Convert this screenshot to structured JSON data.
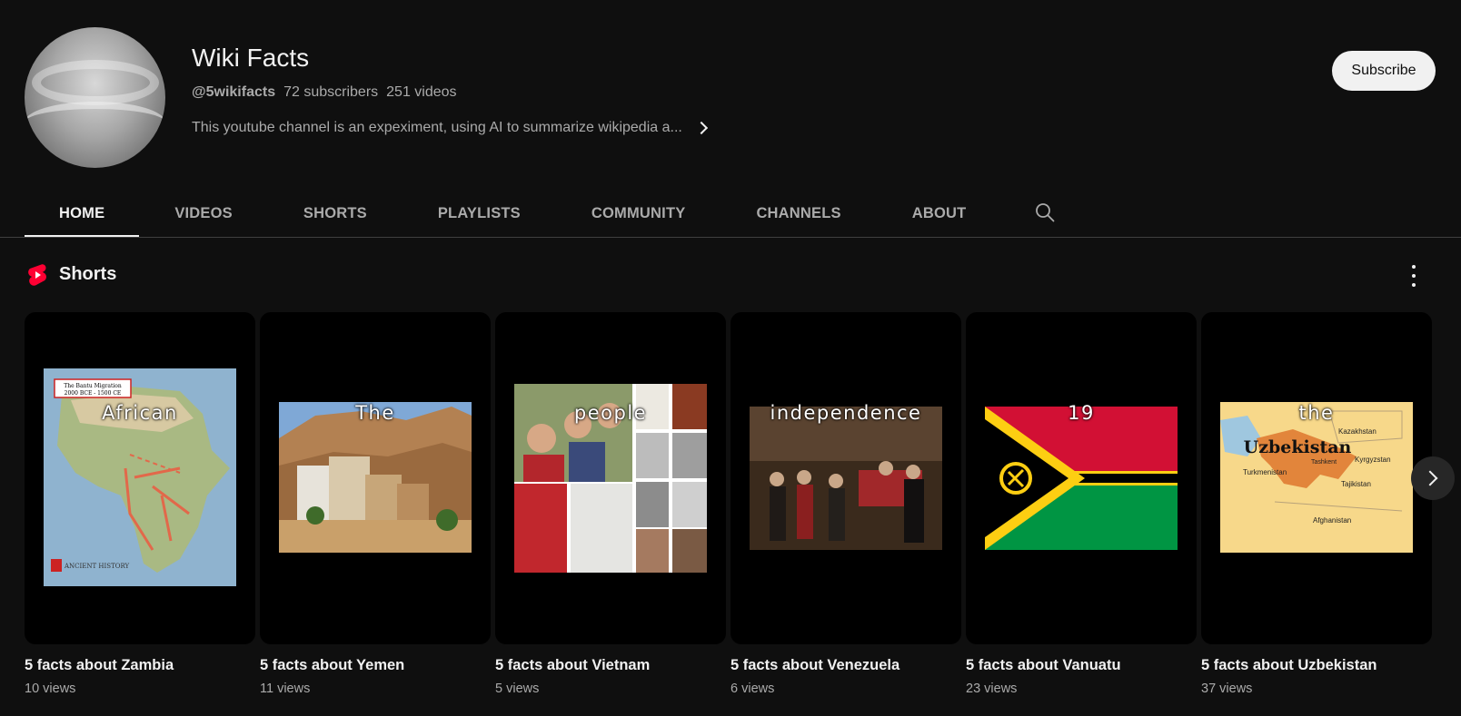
{
  "channel": {
    "name": "Wiki Facts",
    "handle": "@5wikifacts",
    "subscribers": "72 subscribers",
    "videos": "251 videos",
    "description": "This youtube channel is an expeximent, using AI to summarize wikipedia a...",
    "subscribe_label": "Subscribe"
  },
  "tabs": [
    {
      "label": "HOME",
      "active": true
    },
    {
      "label": "VIDEOS"
    },
    {
      "label": "SHORTS"
    },
    {
      "label": "PLAYLISTS"
    },
    {
      "label": "COMMUNITY"
    },
    {
      "label": "CHANNELS"
    },
    {
      "label": "ABOUT"
    }
  ],
  "section": {
    "title": "Shorts",
    "icon": "youtube-shorts-icon"
  },
  "shorts": [
    {
      "title": "5 facts about Zambia",
      "views": "10 views",
      "overlay": "African",
      "map_label_1": "The Bantu Migration",
      "map_label_2": "2000 BCE - 1500 CE",
      "logo_text": "ANCIENT HISTORY"
    },
    {
      "title": "5 facts about Yemen",
      "views": "11 views",
      "overlay": "The"
    },
    {
      "title": "5 facts about Vietnam",
      "views": "5 views",
      "overlay": "people"
    },
    {
      "title": "5 facts about Venezuela",
      "views": "6 views",
      "overlay": "independence"
    },
    {
      "title": "5 facts about Vanuatu",
      "views": "23 views",
      "overlay": "19"
    },
    {
      "title": "5 facts about Uzbekistan",
      "views": "37 views",
      "overlay": "the",
      "map_title": "Uzbekistan",
      "map_labels": [
        "Kazakhstan",
        "Tashkent",
        "Kyrgyzstan",
        "Turkmenistan",
        "Tajikistan",
        "Afghanistan"
      ]
    }
  ],
  "colors": {
    "background": "#0f0f0f",
    "text": "#f1f1f1",
    "secondary_text": "#aaaaaa",
    "shorts_red": "#ff0033"
  }
}
